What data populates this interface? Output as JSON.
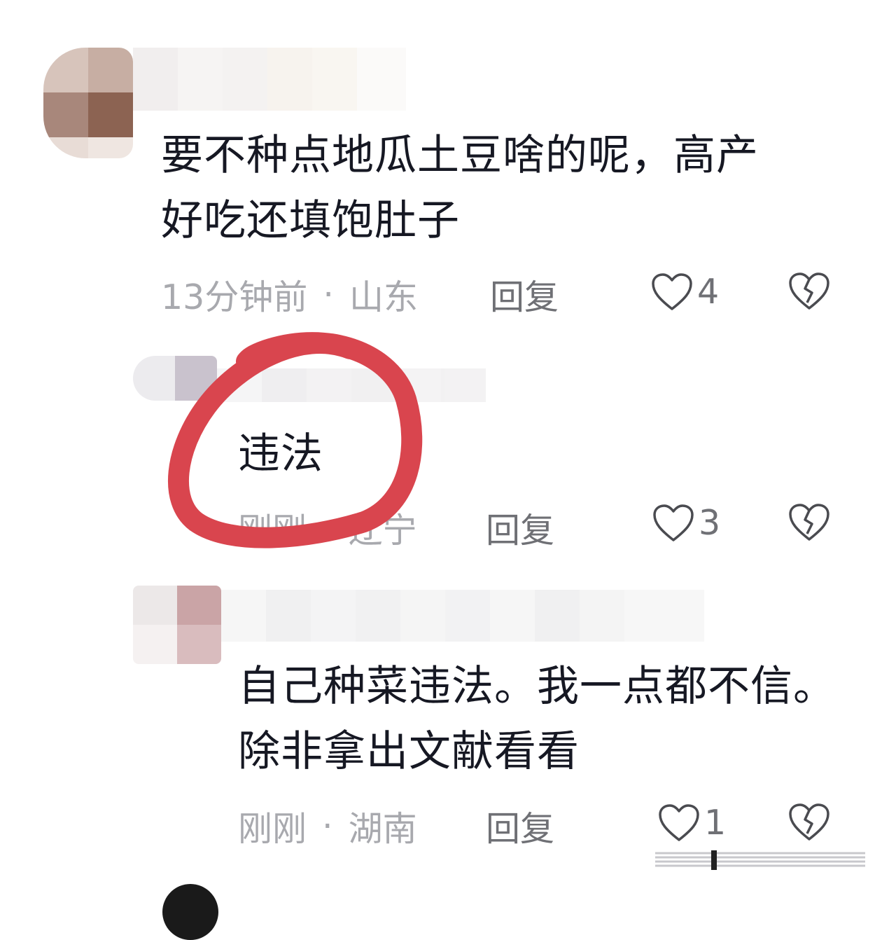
{
  "comments": [
    {
      "text": "要不种点地瓜土豆啥的呢，高产\n好吃还填饱肚子",
      "time": "13分钟前",
      "location": "山东",
      "reply_label": "回复",
      "like_count": "4"
    },
    {
      "text": "违法",
      "time": "刚刚",
      "location": "辽宁",
      "reply_label": "回复",
      "like_count": "3"
    },
    {
      "text": "自己种菜违法。我一点都不信。\n除非拿出文献看看",
      "time": "刚刚",
      "location": "湖南",
      "reply_label": "回复",
      "like_count": "1"
    }
  ],
  "icons": {
    "like": "heart-outline-icon",
    "dislike": "broken-heart-icon"
  },
  "colors": {
    "highlight_circle": "#d9454e",
    "meta_text": "#a8a9ae",
    "action_text": "#6f7075",
    "body_text": "#161823"
  }
}
